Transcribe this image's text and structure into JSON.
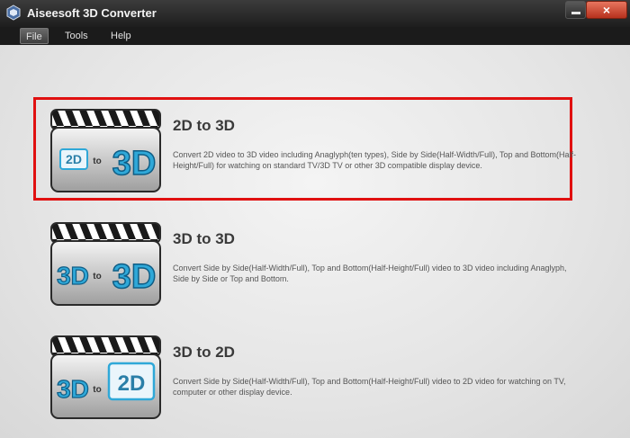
{
  "app": {
    "title": "Aiseesoft 3D Converter"
  },
  "window": {
    "minimize_icon": "minimize-icon",
    "close_label": "×"
  },
  "menu": {
    "file": "File",
    "tools": "Tools",
    "help": "Help"
  },
  "options": [
    {
      "title": "2D to 3D",
      "desc": "Convert 2D video to 3D video including Anaglyph(ten types), Side by Side(Half-Width/Full), Top and Bottom(Half-Height/Full) for watching on standard TV/3D TV or other 3D compatible display device.",
      "thumb": {
        "left": "2D",
        "mid": "to",
        "right": "3D"
      }
    },
    {
      "title": "3D to 3D",
      "desc": "Convert Side by Side(Half-Width/Full), Top and Bottom(Half-Height/Full) video to 3D video including Anaglyph, Side by Side or Top and Bottom.",
      "thumb": {
        "left": "3D",
        "mid": "to",
        "right": "3D"
      }
    },
    {
      "title": "3D to 2D",
      "desc": "Convert Side by Side(Half-Width/Full), Top and Bottom(Half-Height/Full) video to 2D video for watching on TV, computer or other display device.",
      "thumb": {
        "left": "3D",
        "mid": "to",
        "right": "2D"
      }
    }
  ],
  "colors": {
    "highlight": "#e01010",
    "accent3d": "#2fa8d8"
  }
}
